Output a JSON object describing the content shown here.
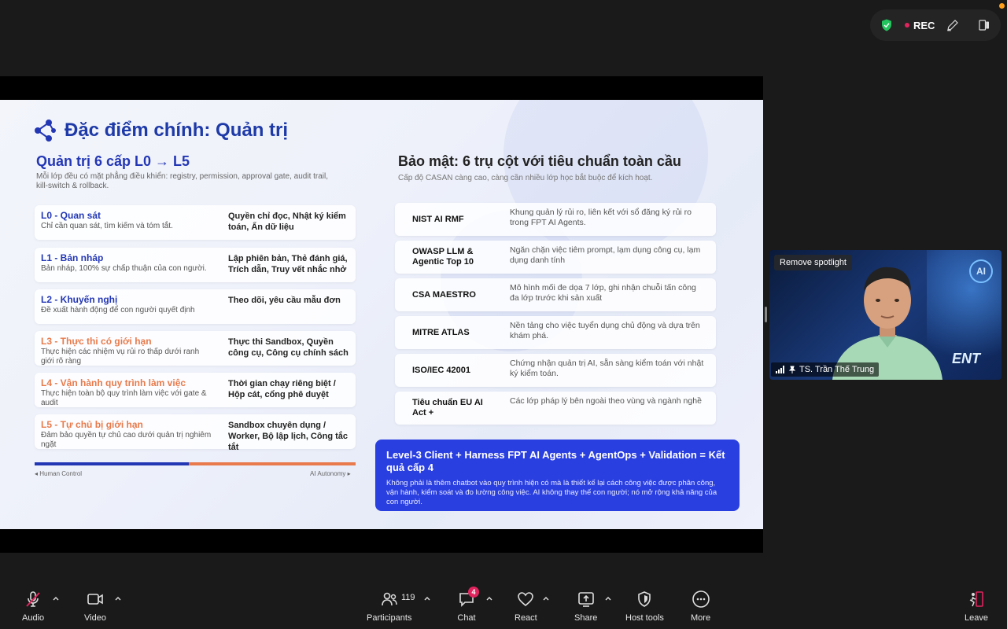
{
  "meeting": {
    "rec_label": "REC"
  },
  "slide": {
    "title": "Đặc điểm chính: Quản trị",
    "left": {
      "heading": "Quản trị 6 cấp L0 → L5",
      "subheading": "Mỗi lớp đều có mặt phẳng điều khiển: registry, permission, approval gate, audit trail, kill-switch & rollback.",
      "levels": [
        {
          "name": "L0 - Quan sát",
          "desc": "Chỉ cần quan sát, tìm kiếm và tóm tắt.",
          "right": "Quyền chỉ đọc, Nhật ký kiểm toán, Ẩn dữ liệu"
        },
        {
          "name": "L1 - Bản nháp",
          "desc": "Bản nháp, 100% sự chấp thuận của con người.",
          "right": "Lập phiên bản, Thẻ đánh giá, Trích dẫn, Truy vết nhắc nhở"
        },
        {
          "name": "L2 - Khuyến nghị",
          "desc": "Đề xuất hành động để con người quyết định",
          "right": "Theo dõi, yêu cầu mẫu đơn"
        },
        {
          "name": "L3 - Thực thi có giới hạn",
          "desc": "Thực hiện các nhiệm vụ rủi ro thấp dưới ranh giới rõ ràng",
          "right": "Thực thi Sandbox, Quyền công cụ, Công cụ chính sách"
        },
        {
          "name": "L4 - Vận hành quy trình làm việc",
          "desc": "Thực hiện toàn bộ quy trình làm việc với gate & audit",
          "right": "Thời gian chạy riêng biệt / Hộp cát, cổng phê duyệt"
        },
        {
          "name": "L5 - Tự chủ bị giới hạn",
          "desc": "Đảm bảo quyền tự chủ cao dưới quản trị nghiêm ngặt",
          "right": "Sandbox chuyên dụng / Worker, Bộ lập lịch, Công tắc tắt"
        }
      ],
      "scale_left": "Human Control",
      "scale_right": "AI Autonomy"
    },
    "right": {
      "heading": "Bảo mật: 6 trụ cột với tiêu chuẩn toàn cầu",
      "subheading": "Cấp độ CASAN càng cao, càng cần nhiều lớp học bắt buộc để kích hoạt.",
      "pillars": [
        {
          "name": "NIST AI RMF",
          "desc": "Khung quản lý rủi ro, liên kết với sổ đăng ký rủi ro trong FPT AI Agents."
        },
        {
          "name": "OWASP LLM & Agentic Top 10",
          "desc": "Ngăn chặn việc tiêm prompt, lạm dụng công cụ, lạm dụng danh tính"
        },
        {
          "name": "CSA MAESTRO",
          "desc": "Mô hình mối đe dọa 7 lớp, ghi nhận chuỗi tấn công đa lớp trước khi sản xuất"
        },
        {
          "name": "MITRE ATLAS",
          "desc": "Nền tảng cho việc tuyển dụng chủ động và dựa trên khám phá."
        },
        {
          "name": "ISO/IEC 42001",
          "desc": "Chứng nhận quản trị AI, sẵn sàng kiểm toán với nhật ký kiểm toán."
        },
        {
          "name": "Tiêu chuẩn EU AI Act +",
          "desc": "Các lớp pháp lý bên ngoài theo vùng và ngành nghề"
        }
      ]
    },
    "callout": {
      "title": "Level-3 Client + Harness FPT AI Agents + AgentOps + Validation = Kết quả cấp 4",
      "body": "Không phải là thêm chatbot vào quy trình hiện có mà là thiết kế lại cách công việc được phân công, vận hành, kiểm soát và đo lường công việc. AI không thay thế con người; nó mở rộng khả năng của con người."
    }
  },
  "video": {
    "remove_spotlight": "Remove spotlight",
    "participant_name": "TS. Trần Thế Trung",
    "bg_badge": "AI",
    "bg_text": "ENT"
  },
  "toolbar": {
    "audio": "Audio",
    "video": "Video",
    "participants": "Participants",
    "participants_count": "119",
    "chat": "Chat",
    "chat_badge": "4",
    "react": "React",
    "share": "Share",
    "host_tools": "Host tools",
    "more": "More",
    "leave": "Leave"
  },
  "colors": {
    "accent_blue": "#2337b5",
    "callout_blue": "#2a3fe0",
    "orange": "#e87a4b",
    "rec_red": "#e0245e",
    "shield_green": "#22c55e"
  }
}
